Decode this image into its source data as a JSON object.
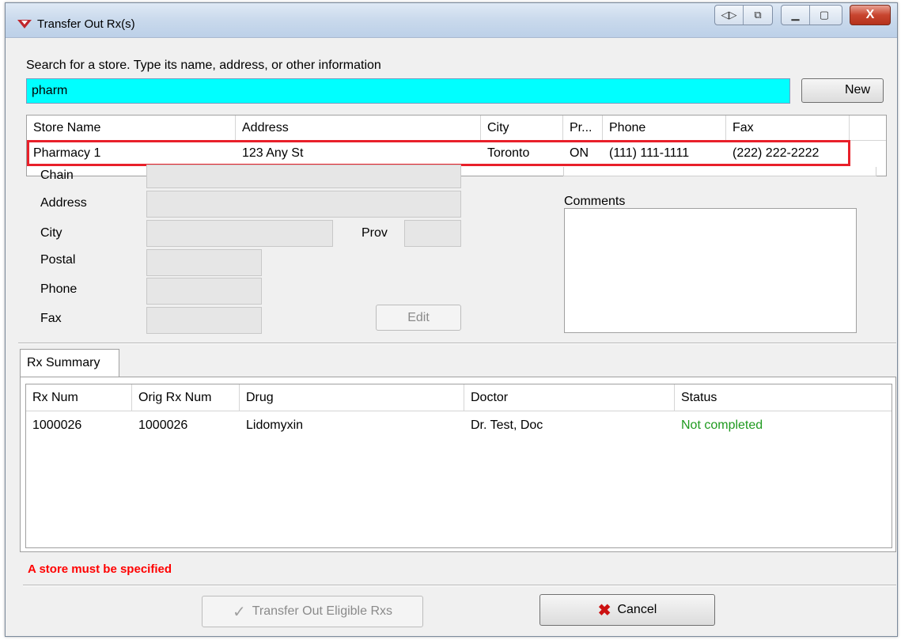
{
  "window": {
    "title": "Transfer Out Rx(s)",
    "close_glyph": "X"
  },
  "search": {
    "label": "Search for a store.  Type its name, address, or other information",
    "value": "pharm",
    "new_label": "New"
  },
  "store_grid": {
    "columns": [
      "Store Name",
      "Address",
      "City",
      "Pr...",
      "Phone",
      "Fax"
    ],
    "rows": [
      {
        "name": "Pharmacy 1",
        "address": "123 Any St",
        "city": "Toronto",
        "prov": "ON",
        "phone": "(111) 111-1111",
        "fax": "(222) 222-2222"
      }
    ]
  },
  "details": {
    "chain_label": "Chain",
    "address_label": "Address",
    "city_label": "City",
    "prov_label": "Prov",
    "postal_label": "Postal",
    "phone_label": "Phone",
    "fax_label": "Fax",
    "edit_label": "Edit",
    "comments_label": "Comments"
  },
  "tabs": [
    {
      "label": "Rx Summary"
    }
  ],
  "rx_grid": {
    "columns": [
      "Rx Num",
      "Orig Rx Num",
      "Drug",
      "Doctor",
      "Status"
    ],
    "rows": [
      {
        "rx_num": "1000026",
        "orig_rx_num": "1000026",
        "drug": "Lidomyxin",
        "doctor": "Dr. Test, Doc",
        "status": "Not completed"
      }
    ]
  },
  "footer": {
    "error": "A store must be specified",
    "transfer_label": "Transfer Out Eligible Rxs",
    "cancel_label": "Cancel"
  },
  "colors": {
    "search_bg": "#00ffff",
    "highlight": "#e8202a",
    "error": "#ff0000",
    "status_ok": "#1f9a1f"
  }
}
